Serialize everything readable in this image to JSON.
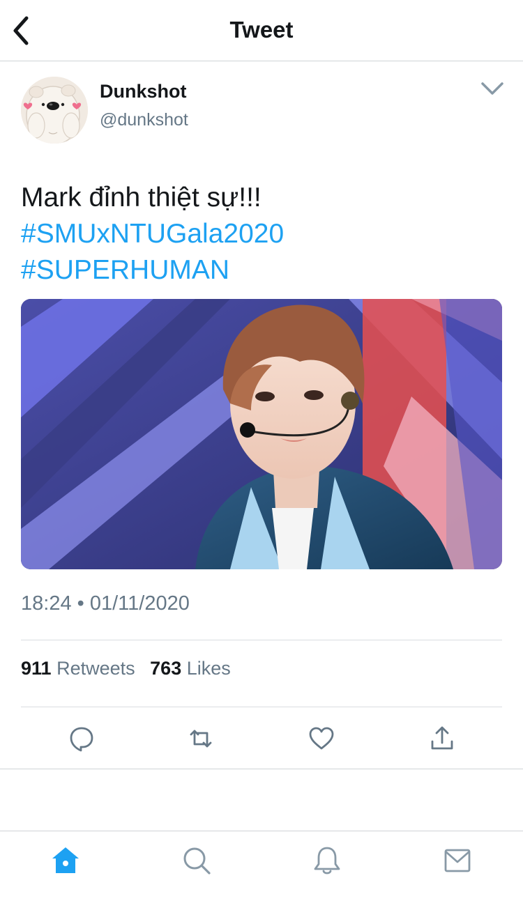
{
  "header": {
    "title": "Tweet",
    "back_icon": "chevron-left-icon"
  },
  "tweet": {
    "author": {
      "name": "Dunkshot",
      "handle": "@dunkshot",
      "avatar_icon": "bear-avatar"
    },
    "text": "Mark đỉnh thiệt sự!!!",
    "hashtags": [
      "#SMUxNTUGala2020",
      "#SUPERHUMAN"
    ],
    "timestamp": "18:24 • 01/11/2020",
    "stats": {
      "retweets_count": "911",
      "retweets_label": "Retweets",
      "likes_count": "763",
      "likes_label": "Likes"
    },
    "actions": [
      "reply-icon",
      "retweet-icon",
      "like-icon",
      "share-icon"
    ]
  },
  "tabbar": {
    "items": [
      "home-icon",
      "search-icon",
      "notifications-icon",
      "messages-icon"
    ],
    "active": "home-icon"
  },
  "colors": {
    "accent": "#1da1f2",
    "secondary_text": "#657786",
    "primary_text": "#14171a",
    "divider": "#cfd3d6"
  }
}
